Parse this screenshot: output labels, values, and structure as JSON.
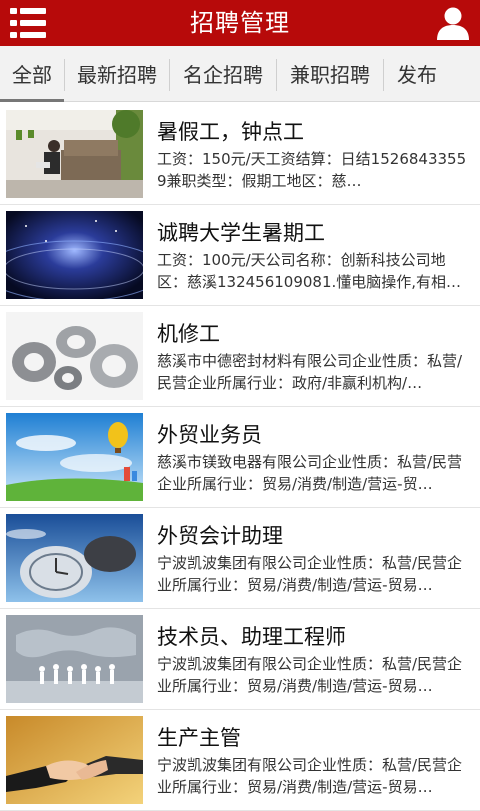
{
  "header": {
    "title": "招聘管理",
    "menu_icon": "menu-list-icon",
    "user_icon": "user-icon",
    "bar_color": "#b70a0a"
  },
  "tabs": [
    {
      "label": "全部",
      "active": true
    },
    {
      "label": "最新招聘",
      "active": false
    },
    {
      "label": "名企招聘",
      "active": false
    },
    {
      "label": "兼职招聘",
      "active": false
    },
    {
      "label": "发布",
      "active": false
    }
  ],
  "jobs": [
    {
      "title": "暑假工，钟点工",
      "desc": "工资：150元/天工资结算：日结15268433559兼职类型：假期工地区：慈…",
      "thumb": "living-room-photo"
    },
    {
      "title": "诚聘大学生暑期工",
      "desc": "工资：100元/天公司名称：创新科技公司地区：慈溪132456109081.懂电脑操作,有相…",
      "thumb": "space-planet-photo"
    },
    {
      "title": "机修工",
      "desc": "慈溪市中德密封材料有限公司企业性质：私营/民营企业所属行业：政府/非赢利机构/…",
      "thumb": "metal-seal-rings-photo"
    },
    {
      "title": "外贸业务员",
      "desc": "慈溪市镁致电器有限公司企业性质：私营/民营企业所属行业：贸易/消费/制造/营运-贸…",
      "thumb": "hot-air-balloon-photo"
    },
    {
      "title": "外贸会计助理",
      "desc": "宁波凯波集团有限公司企业性质：私营/民营企业所属行业：贸易/消费/制造/营运-贸易…",
      "thumb": "globe-clock-photo"
    },
    {
      "title": "技术员、助理工程师",
      "desc": "宁波凯波集团有限公司企业性质：私营/民营企业所属行业：贸易/消费/制造/营运-贸易…",
      "thumb": "people-world-map-photo"
    },
    {
      "title": "生产主管",
      "desc": "宁波凯波集团有限公司企业性质：私营/民营企业所属行业：贸易/消费/制造/营运-贸易…",
      "thumb": "handshake-photo"
    }
  ]
}
